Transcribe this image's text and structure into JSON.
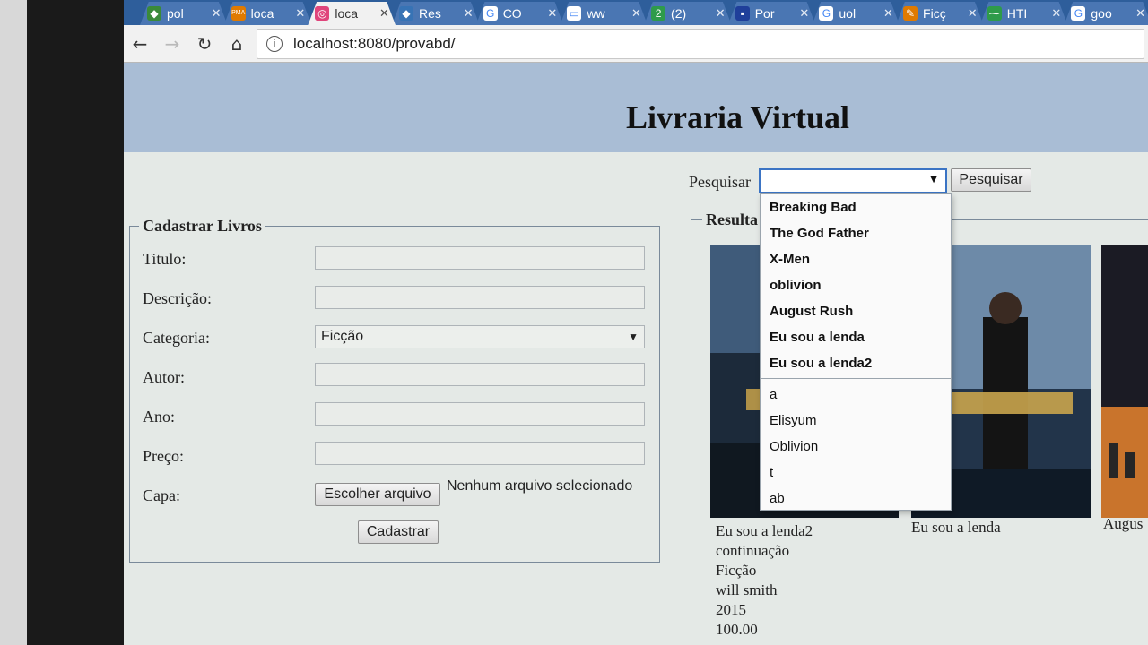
{
  "tabs": [
    {
      "label": "pol",
      "fav_color": "#3a8a3a",
      "fav_glyph": "◆"
    },
    {
      "label": "loca",
      "fav_color": "#e07a00",
      "fav_glyph": "PMA"
    },
    {
      "label": "loca",
      "fav_color": "#e0457b",
      "fav_glyph": "◎"
    },
    {
      "label": "Res",
      "fav_color": "#3773b5",
      "fav_glyph": "◆"
    },
    {
      "label": "CO",
      "fav_color": "#ffffff",
      "fav_glyph": "G"
    },
    {
      "label": "ww",
      "fav_color": "#ffffff",
      "fav_glyph": "▭"
    },
    {
      "label": "(2)",
      "fav_color": "#2e9b4a",
      "fav_glyph": "2"
    },
    {
      "label": "Por",
      "fav_color": "#1f3f9a",
      "fav_glyph": "▪"
    },
    {
      "label": "uol",
      "fav_color": "#ffffff",
      "fav_glyph": "G"
    },
    {
      "label": "Ficç",
      "fav_color": "#e07a00",
      "fav_glyph": "✎"
    },
    {
      "label": "HTI",
      "fav_color": "#2e9b4a",
      "fav_glyph": "⁓"
    },
    {
      "label": "goo",
      "fav_color": "#ffffff",
      "fav_glyph": "G"
    }
  ],
  "toolbar": {
    "url": "localhost:8080/provabd/"
  },
  "page": {
    "title": "Livraria Virtual"
  },
  "form": {
    "legend": "Cadastrar Livros",
    "titulo_label": "Titulo:",
    "descricao_label": "Descrição:",
    "categoria_label": "Categoria:",
    "categoria_value": "Ficção",
    "autor_label": "Autor:",
    "ano_label": "Ano:",
    "preco_label": "Preço:",
    "capa_label": "Capa:",
    "file_button": "Escolher arquivo",
    "file_status": "Nenhum arquivo selecionado",
    "submit_label": "Cadastrar"
  },
  "search": {
    "label": "Pesquisar",
    "button": "Pesquisar",
    "options_group1": [
      "Breaking Bad",
      "The God Father",
      "X-Men",
      "oblivion",
      "August Rush",
      "Eu sou a lenda",
      "Eu sou a lenda2"
    ],
    "options_group2": [
      "a",
      "Elisyum",
      "Oblivion",
      "t",
      "ab"
    ]
  },
  "results": {
    "legend": "Resulta",
    "item1": {
      "title": "Eu sou a lenda2",
      "descricao": "continuação",
      "categoria": "Ficção",
      "autor": "will smith",
      "ano": "2015",
      "preco": "100.00"
    },
    "item2": {
      "title": "Eu sou a lenda"
    },
    "item3": {
      "title": "Augus"
    }
  }
}
